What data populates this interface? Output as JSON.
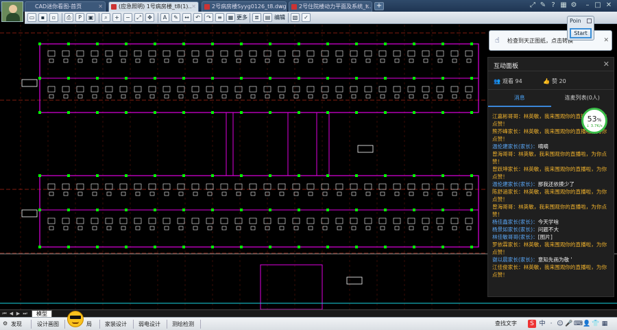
{
  "titlebar": {
    "tabs": [
      {
        "label": "CAD迷你看图-首页",
        "active": false
      },
      {
        "label": "(应急照明) 1号病房楼_t8(1)..",
        "active": true
      },
      {
        "label": "2号病房楼Syyg0126_t8.dwg",
        "active": false
      },
      {
        "label": "2号住院楼动力平面及系统_t..",
        "active": false
      }
    ],
    "new_tab": "+"
  },
  "toolbar": {
    "more_label": "更多",
    "edit_label": "编辑"
  },
  "popup": {
    "message": "检查到天正图纸，点击转换",
    "close": "✕"
  },
  "poin": {
    "label": "Poin",
    "start_label": "Start"
  },
  "panel": {
    "title": "互动面板",
    "close": "✕",
    "viewers_label": "观看 94",
    "likes_label": "赞 20",
    "tab_messages": "消息",
    "tab_mic": "连麦列表(0人)"
  },
  "gauge": {
    "percent": "53",
    "percent_sign": "%",
    "speed": "↓ 3.7K/s"
  },
  "messages": [
    {
      "who": "江嘉彬哥哥：",
      "text": "林英敏，我来围观你的直播啦，为你点赞！",
      "who_blue": false,
      "white": false
    },
    {
      "who": "熊芥峰家长：",
      "text": "林英敏，我来围观你的直播啦，为你点赞！",
      "who_blue": false,
      "white": false
    },
    {
      "who": "温伦建家长(家长)：",
      "text": "嘀嘀",
      "who_blue": true,
      "white": true
    },
    {
      "who": "曾海哥哥：",
      "text": "林英敏，我来围观你的直播啦，为你点赞！",
      "who_blue": false,
      "white": false
    },
    {
      "who": "曾跃坤家长：",
      "text": "林英敏，我来围观你的直播啦，为你点赞！",
      "who_blue": false,
      "white": false
    },
    {
      "who": "温伦建家长(家长)：",
      "text": "那我还依摸少了",
      "who_blue": true,
      "white": true
    },
    {
      "who": "陈舒涵家长：",
      "text": "林英敏，我来围观你的直播啦，为你点赞！",
      "who_blue": false,
      "white": false
    },
    {
      "who": "曾海哥哥：",
      "text": "林英敏，我来围观你的直播啦，为你点赞！",
      "who_blue": false,
      "white": false
    },
    {
      "who": "杨佳鑫家长(家长)：",
      "text": "今天学啥",
      "who_blue": true,
      "white": true
    },
    {
      "who": "杨景如家长(家长)：",
      "text": "问题不大",
      "who_blue": true,
      "white": true
    },
    {
      "who": "林佳敏哥哥(家长)：",
      "text": "[图片]",
      "who_blue": true,
      "white": true
    },
    {
      "who": "罗依霖家长：",
      "text": "林英敏，我来围观你的直播啦，为你点赞！",
      "who_blue": false,
      "white": false
    },
    {
      "who": "谢以晨家长(家长)：",
      "text": "意知先画为敬 '",
      "who_blue": true,
      "white": true
    },
    {
      "who": "江佳俊家长：",
      "text": "林英敏，我来围观你的直播啦，为你点赞！",
      "who_blue": false,
      "white": false
    }
  ],
  "sheetbar": {
    "model_tab": "模型"
  },
  "statusbar": {
    "items": [
      "发现",
      "设计画图",
      "局",
      "家装设计",
      "弱电设计",
      "测绘检测"
    ],
    "search_text": "查找文字"
  },
  "colors": {
    "wall": "#e000e0",
    "fixture": "#ffffff",
    "node": "#00ff00",
    "grid": "#ff3b1f",
    "accent": "#3a86d8",
    "message_yellow": "#f0b22c",
    "message_blue": "#5aa6f5"
  }
}
